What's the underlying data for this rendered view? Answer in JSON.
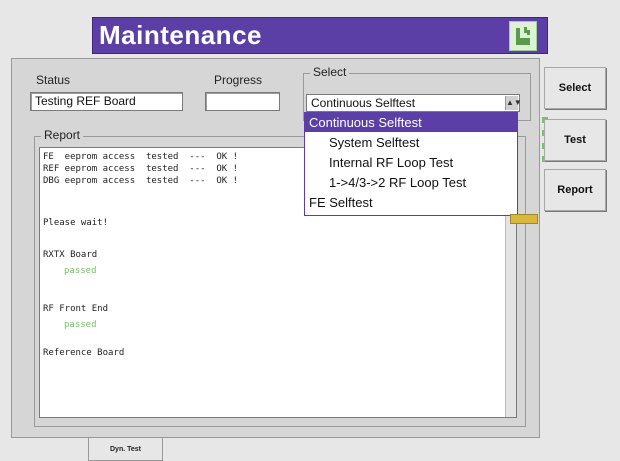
{
  "header": {
    "title": "Maintenance"
  },
  "status": {
    "label": "Status",
    "value": "Testing REF Board"
  },
  "progress": {
    "label": "Progress",
    "value": ""
  },
  "select": {
    "label": "Select",
    "current": "Continuous Selftest",
    "options": [
      "Continuous Selftest",
      "System Selftest",
      "Internal RF Loop Test",
      "1->4/3->2 RF Loop Test",
      "FE Selftest"
    ]
  },
  "report": {
    "label": "Report",
    "lines": [
      "FE  eeprom access  tested  ---  OK !",
      "REF eeprom access  tested  ---  OK !",
      "DBG eeprom access  tested  ---  OK !",
      "Please wait!",
      "RXTX Board",
      "passed",
      "RF Front End",
      "passed",
      "Reference Board"
    ]
  },
  "side_buttons": {
    "select": "Select",
    "test": "Test",
    "report": "Report"
  },
  "tabs": {
    "dyn_test": "Dyn. Test"
  },
  "colors": {
    "accent": "#5b3fa6",
    "passed": "#79c26a"
  }
}
